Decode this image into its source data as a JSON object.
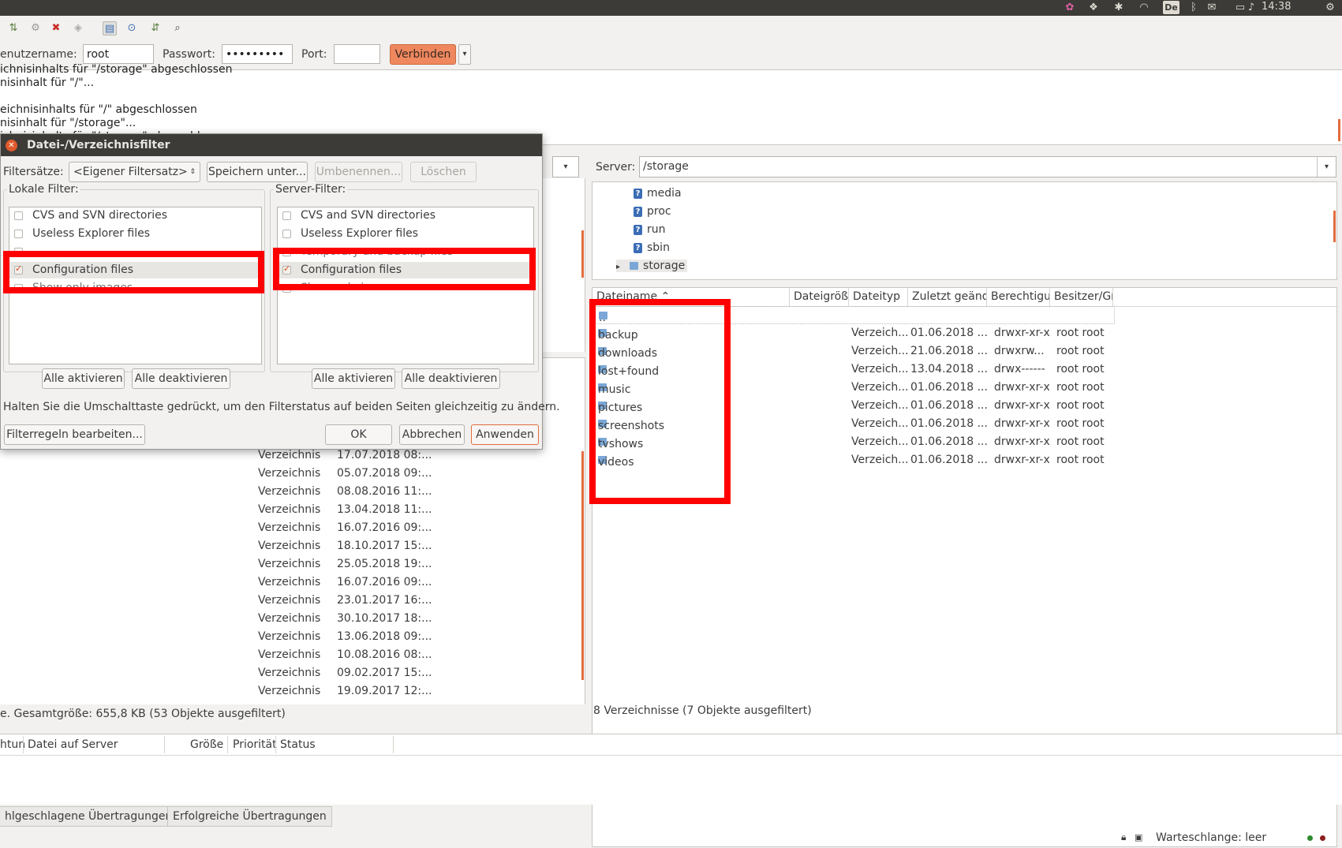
{
  "topbar": {
    "keyboard_layout": "De",
    "clock": "14:38",
    "icons": [
      "colorful-app-icon",
      "dropbox-icon",
      "puzzle-icon",
      "wifi-icon",
      "keyboard-layout-icon",
      "bluetooth-icon",
      "mail-icon",
      "battery-icon",
      "volume-icon",
      "clock",
      "gear-icon"
    ]
  },
  "toolbar": {
    "icons": [
      "sync-icon",
      "process-queue-icon",
      "cancel-icon",
      "disconnect-icon",
      "filter-icon",
      "compare-icon",
      "sync-browse-icon",
      "search-icon"
    ]
  },
  "quickconnect": {
    "user_label": "enutzername:",
    "user_value": "root",
    "pass_label": "Passwort:",
    "pass_value": "•••••••••",
    "port_label": "Port:",
    "port_value": "",
    "connect_label": "Verbinden",
    "dropdown_glyph": "▾"
  },
  "log": {
    "lines": [
      "ichnisinhalts für \"/storage\" abgeschlossen",
      "nisinhalt für \"/\"...",
      "",
      "eichnisinhalts für \"/\" abgeschlossen",
      "nisinhalt für \"/storage\"...",
      "ichnisinhalts für \"/storage\" abgeschl..."
    ]
  },
  "local": {
    "rows": [
      {
        "type": "Verzeichnis",
        "date": "17.07.2018 08:..."
      },
      {
        "type": "Verzeichnis",
        "date": "05.07.2018 09:..."
      },
      {
        "type": "Verzeichnis",
        "date": "08.08.2016 11:..."
      },
      {
        "type": "Verzeichnis",
        "date": "13.04.2018 11:..."
      },
      {
        "type": "Verzeichnis",
        "date": "16.07.2016 09:..."
      },
      {
        "type": "Verzeichnis",
        "date": "18.10.2017 15:..."
      },
      {
        "type": "Verzeichnis",
        "date": "25.05.2018 19:..."
      },
      {
        "type": "Verzeichnis",
        "date": "16.07.2016 09:..."
      },
      {
        "type": "Verzeichnis",
        "date": "23.01.2017 16:..."
      },
      {
        "type": "Verzeichnis",
        "date": "30.10.2017 18:..."
      },
      {
        "type": "Verzeichnis",
        "date": "13.06.2018 09:..."
      },
      {
        "type": "Verzeichnis",
        "date": "10.08.2016 08:..."
      },
      {
        "type": "Verzeichnis",
        "date": "09.02.2017 15:..."
      },
      {
        "type": "Verzeichnis",
        "date": "19.09.2017 12:..."
      }
    ],
    "status": "e. Gesamtgröße: 655,8 KB (53 Objekte ausgefiltert)"
  },
  "server": {
    "path_label": "Server:",
    "path_value": "/storage",
    "tree": [
      {
        "name": "media"
      },
      {
        "name": "proc"
      },
      {
        "name": "run"
      },
      {
        "name": "sbin"
      },
      {
        "name": "storage"
      }
    ],
    "expander": "▸",
    "columns": [
      "Dateiname ⌃",
      "Dateigröße",
      "Dateityp",
      "Zuletzt geändert",
      "Berechtigungen",
      "Besitzer/Gruppe"
    ],
    "parent": "..",
    "rows": [
      {
        "name": "backup",
        "type": "Verzeich...",
        "date": "01.06.2018 ...",
        "perm": "drwxr-xr-x",
        "owner": "root root"
      },
      {
        "name": "downloads",
        "type": "Verzeich...",
        "date": "21.06.2018 ...",
        "perm": "drwxrw...",
        "owner": "root root"
      },
      {
        "name": "lost+found",
        "type": "Verzeich...",
        "date": "13.04.2018 ...",
        "perm": "drwx------",
        "owner": "root root"
      },
      {
        "name": "music",
        "type": "Verzeich...",
        "date": "01.06.2018 ...",
        "perm": "drwxr-xr-x",
        "owner": "root root"
      },
      {
        "name": "pictures",
        "type": "Verzeich...",
        "date": "01.06.2018 ...",
        "perm": "drwxr-xr-x",
        "owner": "root root"
      },
      {
        "name": "screenshots",
        "type": "Verzeich...",
        "date": "01.06.2018 ...",
        "perm": "drwxr-xr-x",
        "owner": "root root"
      },
      {
        "name": "tvshows",
        "type": "Verzeich...",
        "date": "01.06.2018 ...",
        "perm": "drwxr-xr-x",
        "owner": "root root"
      },
      {
        "name": "videos",
        "type": "Verzeich...",
        "date": "01.06.2018 ...",
        "perm": "drwxr-xr-x",
        "owner": "root root"
      }
    ],
    "status": "8 Verzeichnisse (7 Objekte ausgefiltert)"
  },
  "queue": {
    "columns": [
      "htun",
      "Datei auf Server",
      "Größe",
      "Priorität",
      "Status"
    ]
  },
  "tabs": [
    "hlgeschlagene Übertragungen",
    "Erfolgreiche Übertragungen"
  ],
  "statusbar": {
    "queue_text": "Warteschlange: leer"
  },
  "dialog": {
    "title": "Datei-/Verzeichnisfilter",
    "filtersets_label": "Filtersätze:",
    "filterset_value": "<Eigener Filtersatz>",
    "save_as": "Speichern unter...",
    "rename": "Umbenennen...",
    "delete": "Löschen",
    "local_label": "Lokale Filter:",
    "server_label": "Server-Filter:",
    "local_items": [
      {
        "label": "CVS and SVN directories",
        "checked": false
      },
      {
        "label": "Useless Explorer files",
        "checked": false
      },
      {
        "label": "Temporary and backup files",
        "checked": false
      },
      {
        "label": "Configuration files",
        "checked": true
      },
      {
        "label": "Show only images",
        "checked": false
      }
    ],
    "server_items": [
      {
        "label": "CVS and SVN directories",
        "checked": false
      },
      {
        "label": "Useless Explorer files",
        "checked": false
      },
      {
        "label": "Temporary and backup files",
        "checked": false
      },
      {
        "label": "Configuration files",
        "checked": true
      },
      {
        "label": "Show only images",
        "checked": false
      }
    ],
    "enable_all": "Alle aktivieren",
    "disable_all": "Alle deaktivieren",
    "hint": "Halten Sie die Umschalttaste gedrückt, um den Filterstatus auf beiden Seiten gleichzeitig zu ändern.",
    "edit_rules": "Filterregeln bearbeiten...",
    "ok": "OK",
    "cancel": "Abbrechen",
    "apply": "Anwenden"
  },
  "colors": {
    "accent": "#f0885f",
    "highlight": "#ff0000",
    "titlebar": "#3c3b37"
  }
}
